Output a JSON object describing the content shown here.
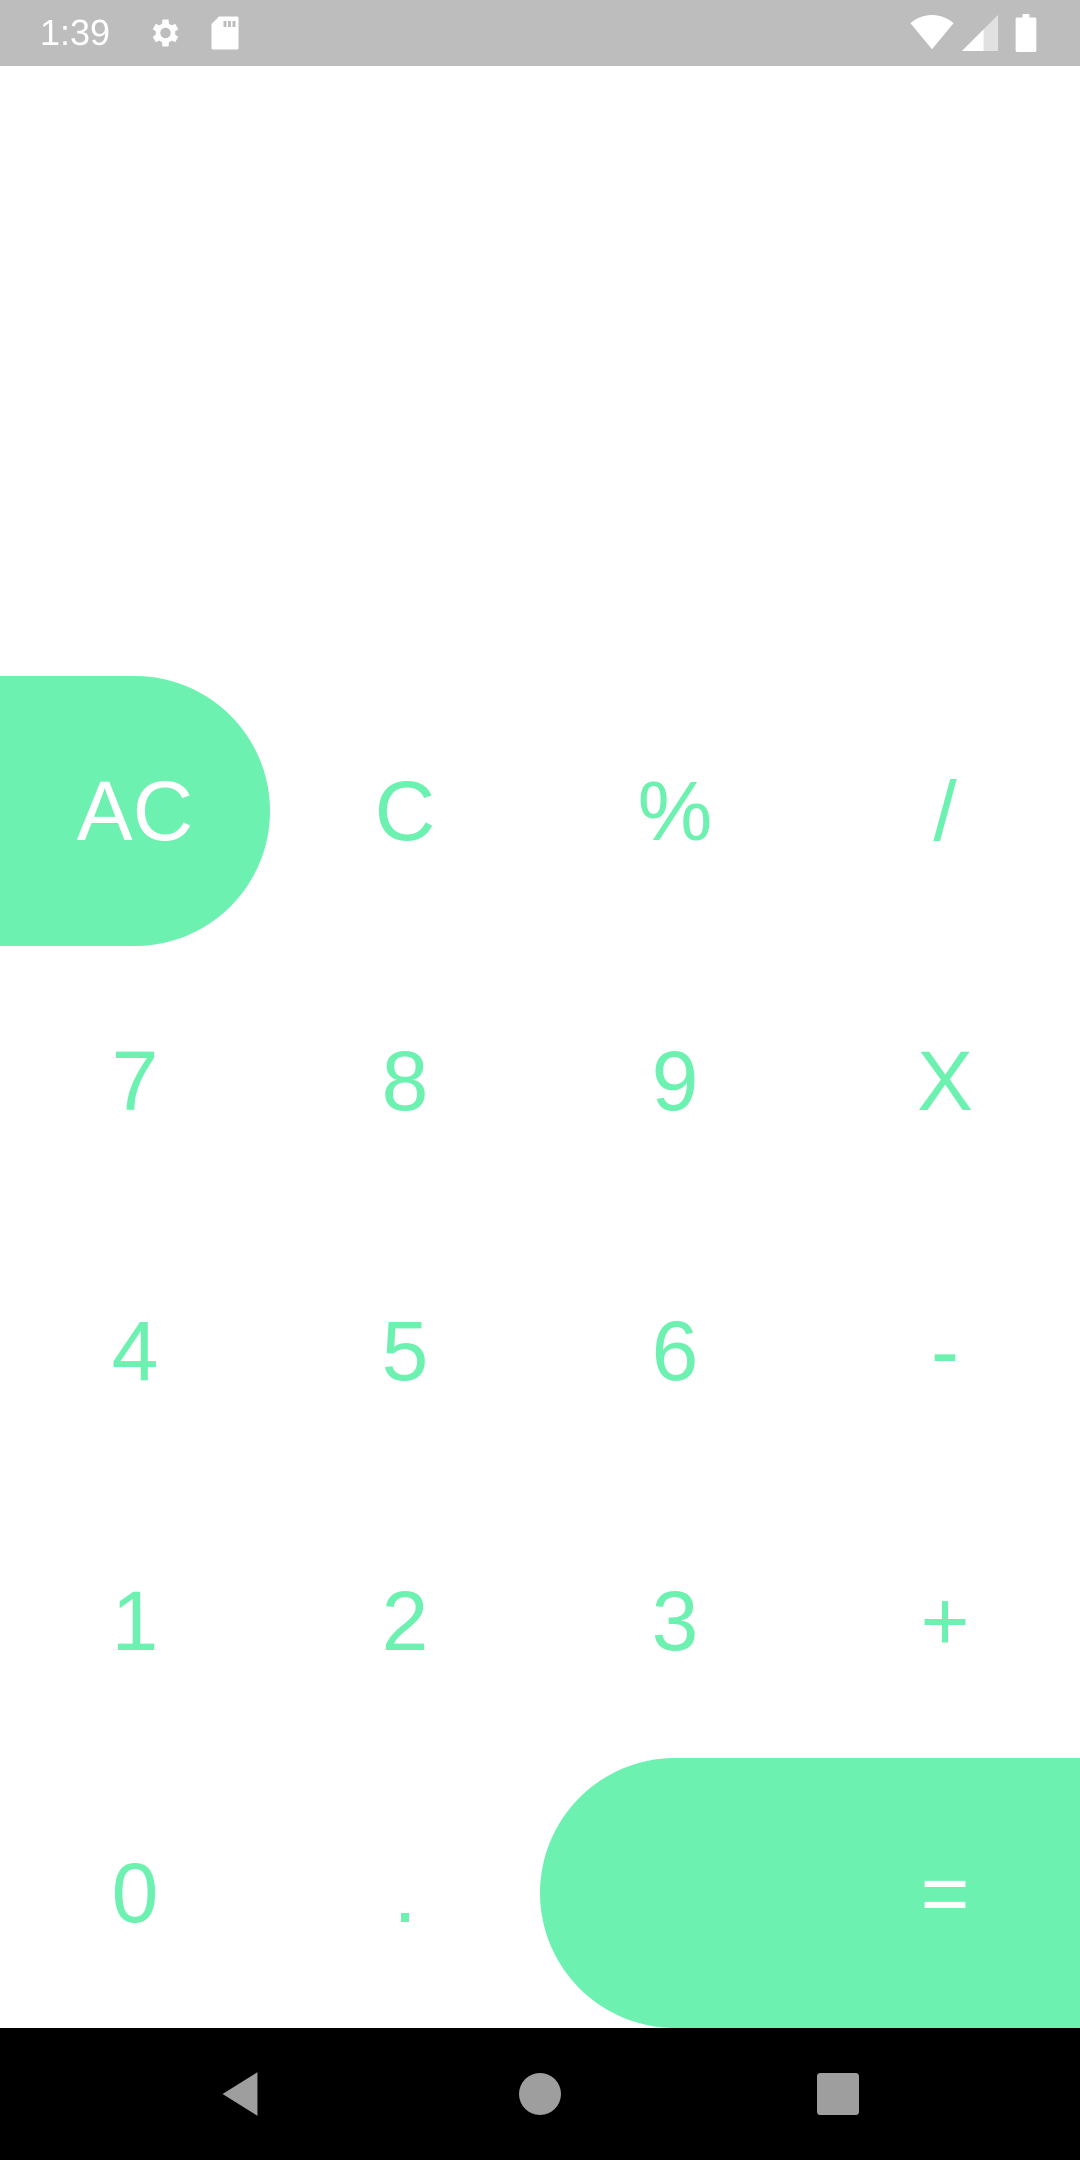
{
  "status_bar": {
    "time": "1:39",
    "icons": [
      "gear-icon",
      "sd-card-icon",
      "wifi-icon",
      "signal-icon",
      "battery-icon"
    ]
  },
  "display": {
    "value": ""
  },
  "keypad": {
    "row1": [
      "AC",
      "C",
      "%",
      "/"
    ],
    "row2": [
      "7",
      "8",
      "9",
      "X"
    ],
    "row3": [
      "4",
      "5",
      "6",
      "-"
    ],
    "row4": [
      "1",
      "2",
      "3",
      "+"
    ],
    "row5": [
      "0",
      ".",
      "="
    ]
  },
  "colors": {
    "accent": "#6cf1b0",
    "status_bar": "#bdbdbd",
    "nav_bar": "#000000",
    "background": "#ffffff"
  },
  "nav_bar": {
    "icons": [
      "back-icon",
      "home-icon",
      "recents-icon"
    ]
  }
}
